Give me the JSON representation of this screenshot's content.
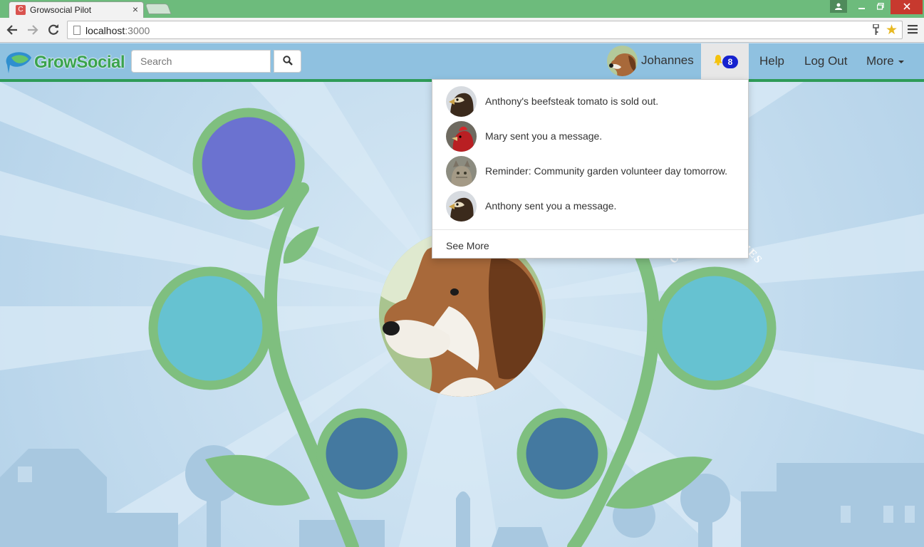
{
  "browser": {
    "tab_title": "Growsocial Pilot",
    "tab_close": "×",
    "url_host": "localhost",
    "url_port": ":3000"
  },
  "navbar": {
    "brand": "GrowSocial",
    "search_placeholder": "Search",
    "user_name": "Johannes",
    "notification_count": "8",
    "links": {
      "help": "Help",
      "logout": "Log Out",
      "more": "More"
    }
  },
  "notifications": {
    "items": [
      {
        "text": "Anthony's beefsteak tomato is sold out.",
        "avatar": "eagle"
      },
      {
        "text": "Mary sent you a message.",
        "avatar": "rooster"
      },
      {
        "text": "Reminder: Community garden volunteer day tomorrow.",
        "avatar": "cat"
      },
      {
        "text": "Anthony sent you a message.",
        "avatar": "eagle"
      }
    ],
    "see_more": "See More"
  },
  "scene": {
    "circle_label": "OPPORTUNITIES"
  },
  "colors": {
    "navbar": "#8fc1e0",
    "accent_line": "#2e9b58",
    "stem": "#7fbf7f",
    "circle_purple": "#6b72d0",
    "circle_teal": "#66c2d1",
    "circle_blue": "#4479a0",
    "badge": "#1622cf"
  }
}
